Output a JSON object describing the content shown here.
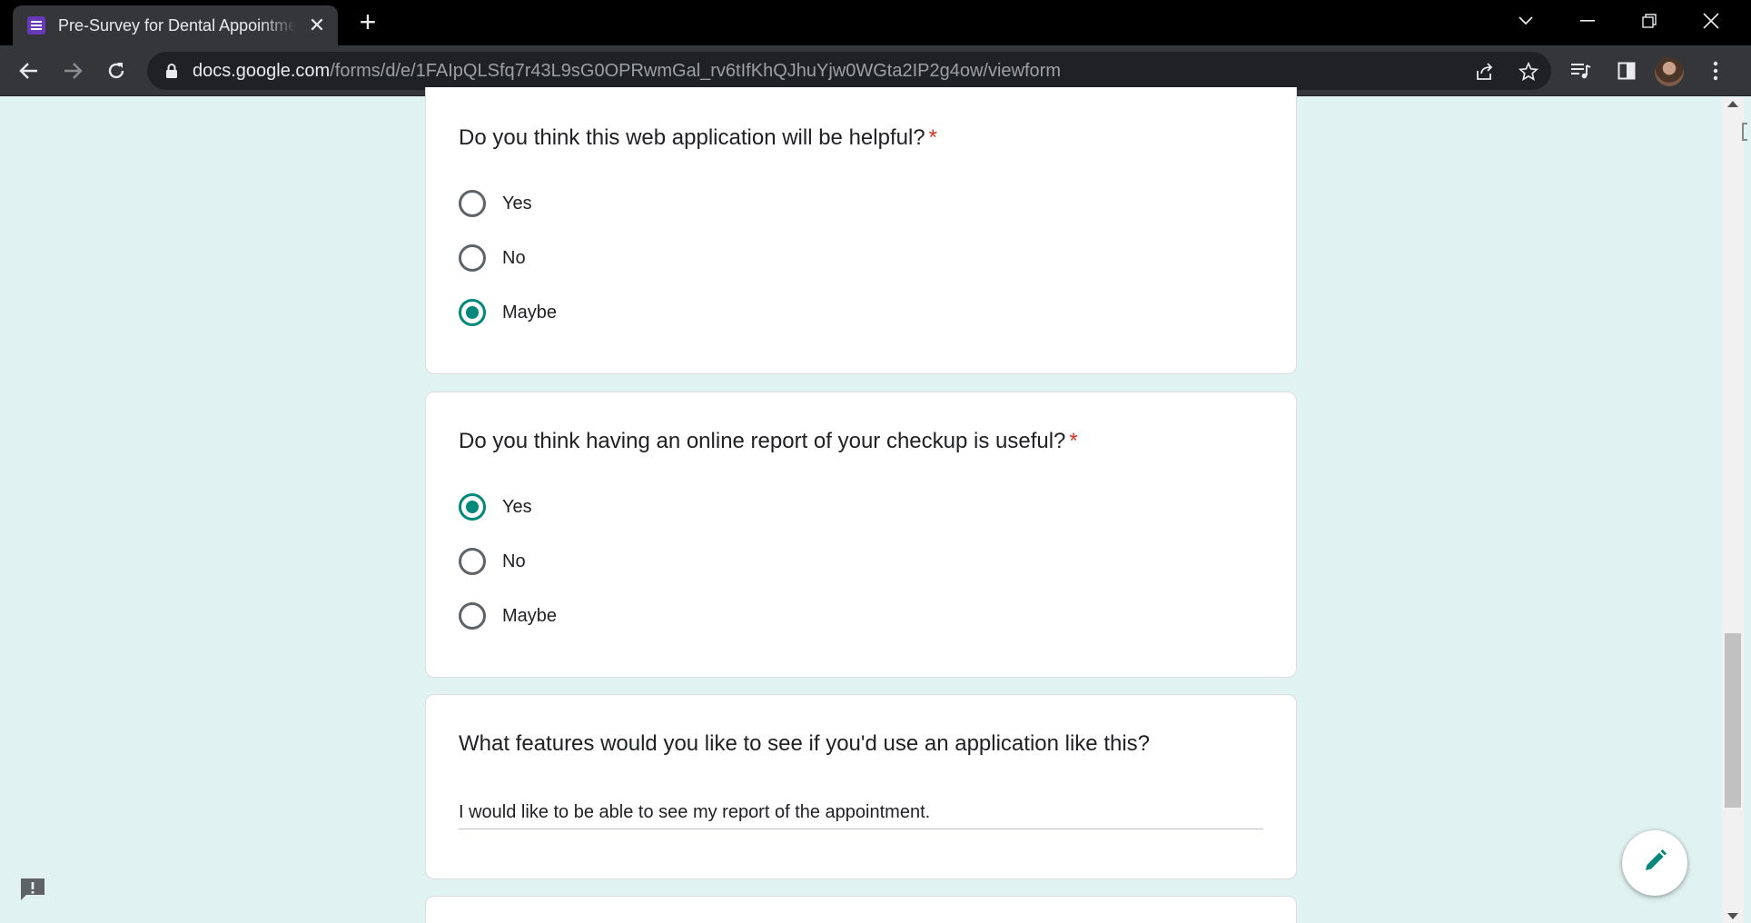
{
  "browser": {
    "tab_title": "Pre-Survey for Dental Appointment",
    "url_host": "docs.google.com",
    "url_path": "/forms/d/e/1FAIpQLSfq7r43L9sG0OPRwmGal_rv6tIfKhQJhuYjw0WGta2IP2g4ow/viewform"
  },
  "form": {
    "accent_color": "#00897b",
    "background_color": "#e0f2f1",
    "q1": {
      "text": "Do you think this web application will be helpful?",
      "required_mark": "*",
      "options": [
        "Yes",
        "No",
        "Maybe"
      ],
      "selected": "Maybe"
    },
    "q2": {
      "text": "Do you think having an online report of your checkup is useful?",
      "required_mark": "*",
      "options": [
        "Yes",
        "No",
        "Maybe"
      ],
      "selected": "Yes"
    },
    "q3": {
      "text": "What features would you like to see if you'd use an application like this?",
      "answer": "I would like to be able to see my report of the appointment."
    }
  },
  "icons": {
    "favicon": "google-forms-icon",
    "feedback": "report-problem-icon",
    "edit": "pencil-icon"
  }
}
